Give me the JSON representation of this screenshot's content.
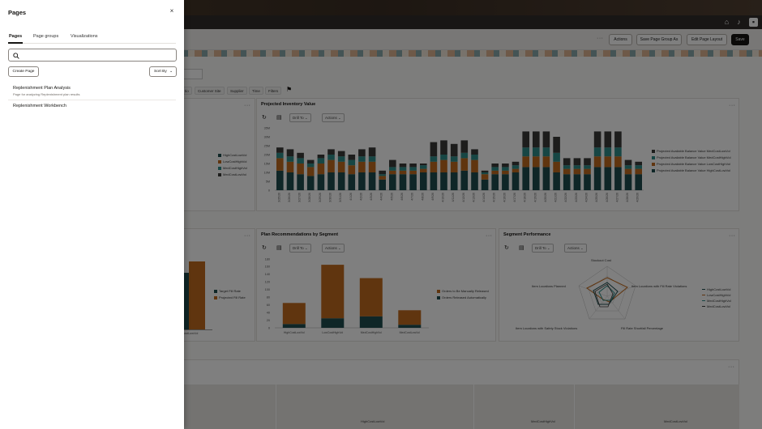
{
  "app": {
    "toolbar": {
      "more_label": "···",
      "actions_label": "Actions",
      "save_group_as_label": "Save Page Group As",
      "edit_layout_label": "Edit Page Layout",
      "save_label": "Save"
    },
    "filters": [
      "tio",
      "Customer Site",
      "Supplier",
      "Time",
      "Filters"
    ],
    "common": {
      "drill_to_label": "Drill To",
      "actions_label": "Actions",
      "more_label": "···"
    },
    "projected_inventory_value": {
      "title": "Projected Inventory Value",
      "y_ticks": [
        "35M",
        "30M",
        "25M",
        "20M",
        "15M",
        "10M",
        "5M",
        "0"
      ],
      "dates": [
        "3/25/26",
        "3/26/26",
        "3/27/26",
        "3/28/26",
        "3/29/26",
        "3/30/26",
        "3/31/26",
        "4/1/26",
        "4/2/26",
        "4/3/26",
        "4/4/26",
        "4/5/26",
        "4/6/26",
        "4/7/26",
        "4/8/26",
        "4/9/26",
        "4/10/26",
        "4/11/26",
        "4/12/26",
        "4/13/26",
        "4/14/26",
        "4/15/26",
        "4/16/26",
        "4/17/26",
        "4/18/26",
        "4/19/26",
        "4/20/26",
        "4/21/26",
        "4/22/26",
        "4/23/26",
        "4/24/26",
        "4/25/26",
        "4/26/26",
        "4/27/26",
        "4/28/26",
        "4/29/26"
      ],
      "legend": [
        "Projected Available Balance Value MedCostLowVol",
        "Projected Available Balance Value MedCostHighVol",
        "Projected Available Balance Value LowCostHighVol",
        "Projected Available Balance Value HighCostLowVol"
      ],
      "colors": [
        "#3a3a38",
        "#2f8c88",
        "#c16a1e",
        "#1e4d4f"
      ]
    },
    "left_chart_legend": [
      "HighCostLowVol",
      "LowCostHighVol",
      "MedCostHighVol",
      "MedCostLowVol"
    ],
    "fill_rate": {
      "legend": [
        "Target Fill Rate",
        "Projected Fill Rate"
      ],
      "x_label": "ostLowVol"
    },
    "plan_recommendations": {
      "title": "Plan Recommendations by Segment",
      "categories": [
        "HighCostLowVol",
        "LowCostHighVol",
        "MedCostHighVol",
        "MedCostLowVol"
      ],
      "y_ticks": [
        "180",
        "160",
        "140",
        "120",
        "100",
        "80",
        "60",
        "40",
        "20",
        "0"
      ],
      "legend": [
        "Orders to Be Manually Released",
        "Orders Released Automatically"
      ]
    },
    "segment_performance": {
      "title": "Segment Performance",
      "axes": [
        "Stockout Cost",
        "Item Locations with Fill Rate Violations",
        "Fill Rate Shortfall Percentage",
        "Item Locations with Safety Stock Violations",
        "Item Locations Planned"
      ],
      "legend": [
        "HighCostLowVol",
        "LowCostHighVol",
        "MedCostHighVol",
        "MedCostLowVol"
      ]
    },
    "bottom_labels": [
      "HighCostLowVol",
      "MedCostHighVol",
      "MedCostLowVol"
    ]
  },
  "chart_data": [
    {
      "type": "bar",
      "title": "Projected Inventory Value",
      "categories": [
        "3/25/26",
        "3/26/26",
        "3/27/26",
        "3/28/26",
        "3/29/26",
        "3/30/26",
        "3/31/26",
        "4/1/26",
        "4/2/26",
        "4/3/26",
        "4/4/26",
        "4/5/26",
        "4/6/26",
        "4/7/26",
        "4/8/26",
        "4/9/26",
        "4/10/26",
        "4/11/26",
        "4/12/26",
        "4/13/26",
        "4/14/26",
        "4/15/26",
        "4/16/26",
        "4/17/26",
        "4/18/26",
        "4/19/26",
        "4/20/26",
        "4/21/26",
        "4/22/26",
        "4/23/26",
        "4/24/26",
        "4/25/26",
        "4/26/26",
        "4/27/26",
        "4/28/26",
        "4/29/26"
      ],
      "ylim": [
        0,
        35
      ],
      "stacked": true,
      "series": [
        {
          "name": "Projected Available Balance Value HighCostLowVol",
          "values": [
            11,
            10,
            9,
            8,
            9,
            10,
            10,
            9,
            10,
            10,
            6,
            9,
            9,
            9,
            10,
            10,
            10,
            10,
            11,
            10,
            6,
            9,
            9,
            10,
            13,
            13,
            13,
            10,
            9,
            9,
            9,
            13,
            13,
            13,
            9,
            9
          ]
        },
        {
          "name": "Projected Available Balance Value LowCostHighVol",
          "values": [
            7,
            6,
            6,
            5,
            6,
            7,
            6,
            5,
            6,
            6,
            2,
            2,
            2,
            2,
            2,
            6,
            7,
            6,
            7,
            7,
            3,
            2,
            2,
            2,
            6,
            6,
            6,
            6,
            3,
            3,
            3,
            6,
            6,
            6,
            3,
            3
          ]
        },
        {
          "name": "Projected Available Balance Value MedCostHighVol",
          "values": [
            3,
            3,
            3,
            2,
            3,
            3,
            3,
            3,
            3,
            3,
            1,
            2,
            2,
            2,
            2,
            3,
            3,
            3,
            3,
            3,
            1,
            2,
            2,
            2,
            5,
            5,
            5,
            5,
            2,
            2,
            2,
            5,
            5,
            5,
            2,
            2
          ]
        },
        {
          "name": "Projected Available Balance Value MedCostLowVol",
          "values": [
            3,
            4,
            3,
            2,
            2,
            3,
            3,
            3,
            4,
            5,
            2,
            4,
            2,
            2,
            1,
            8,
            8,
            7,
            7,
            3,
            1,
            2,
            2,
            2,
            9,
            9,
            9,
            9,
            4,
            4,
            4,
            9,
            9,
            9,
            3,
            2
          ]
        }
      ]
    },
    {
      "type": "bar",
      "title": "Plan Recommendations by Segment",
      "categories": [
        "HighCostLowVol",
        "LowCostHighVol",
        "MedCostHighVol",
        "MedCostLowVol"
      ],
      "ylim": [
        0,
        180
      ],
      "stacked": true,
      "series": [
        {
          "name": "Orders Released Automatically",
          "values": [
            10,
            25,
            30,
            8
          ]
        },
        {
          "name": "Orders to Be Manually Released",
          "values": [
            55,
            140,
            100,
            38
          ]
        }
      ]
    }
  ],
  "drawer": {
    "title": "Pages",
    "close_label": "×",
    "tabs": [
      "Pages",
      "Page groups",
      "Visualizations"
    ],
    "search_placeholder": "",
    "create_label": "Create Page",
    "sort_label": "Sort By",
    "items": [
      {
        "name": "Replenishment Plan Analysis",
        "desc": "Page for analyzing Replenishment plan results"
      },
      {
        "name": "Replenishment Workbench",
        "desc": ""
      }
    ]
  }
}
